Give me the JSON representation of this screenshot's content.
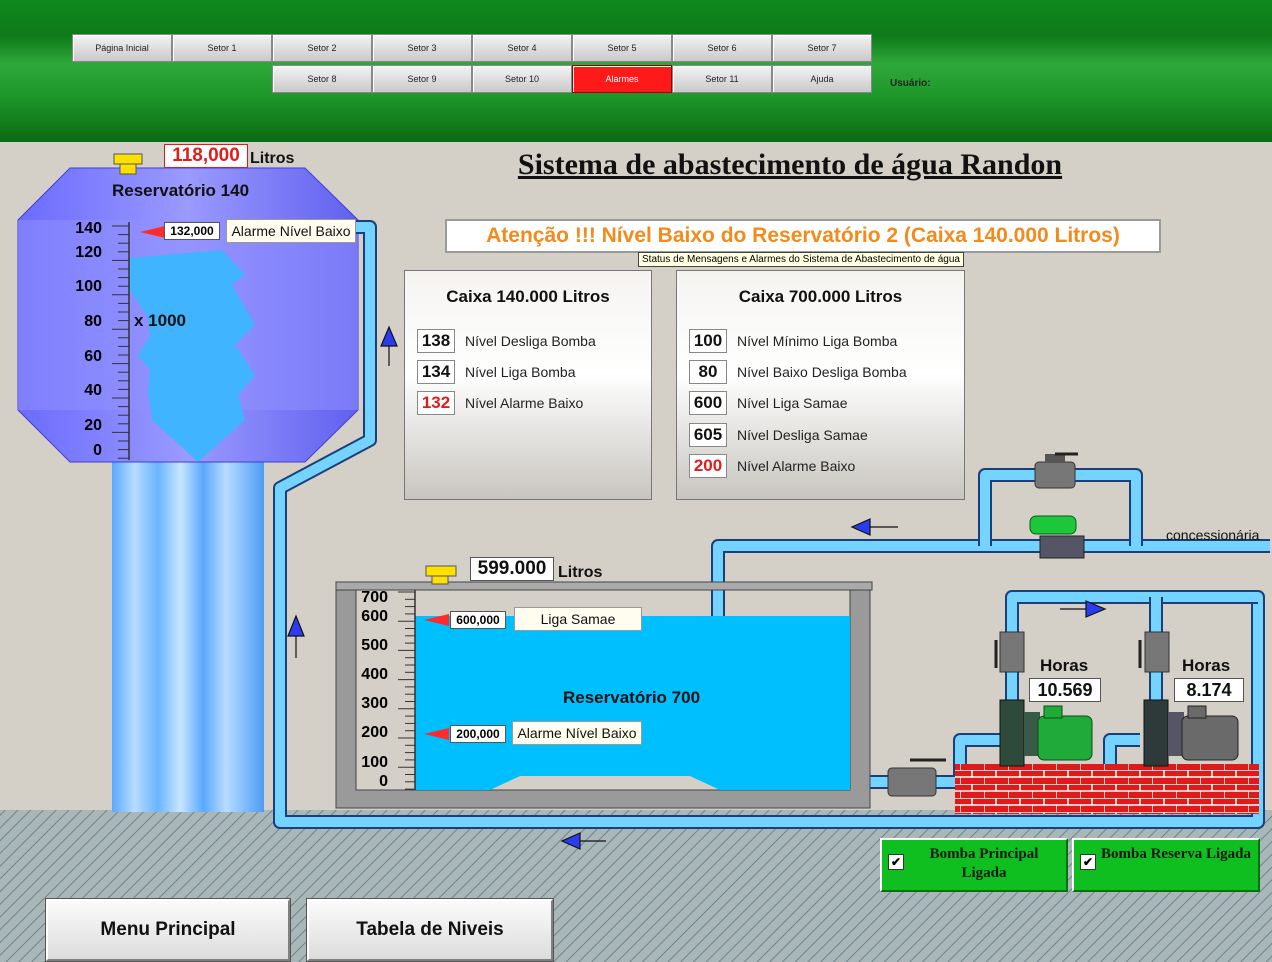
{
  "nav": {
    "row1": [
      "Página Inicial",
      "Setor 1",
      "Setor 2",
      "Setor 3",
      "Setor 4",
      "Setor 5",
      "Setor 6",
      "Setor 7"
    ],
    "row2": [
      "Setor 8",
      "Setor 9",
      "Setor 10",
      "Alarmes",
      "Setor 11",
      "Ajuda"
    ],
    "usuario_label": "Usuário:"
  },
  "colors": {
    "alarm_button": "#ff1a1a",
    "water": "#00bfff",
    "header_green": "#0e7a18",
    "alert_text": "#f28a1c"
  },
  "title": "Sistema de abastecimento de água Randon",
  "alert": {
    "message": "Atenção !!! Nível Baixo do Reservatório 2 (Caixa 140.000 Litros)",
    "tooltip": "Status de Mensagens e Alarmes do Sistema de Abastecimento de água"
  },
  "reservoir140": {
    "volume": "118,000",
    "volume_unit": "Litros",
    "name": "Reservatório 140",
    "scale_unit": "x 1000",
    "ticks": [
      "140",
      "120",
      "100",
      "80",
      "60",
      "40",
      "20",
      "0"
    ],
    "alarm_value": "132,000",
    "alarm_label": "Alarme Nível Baixo"
  },
  "panel140": {
    "title": "Caixa 140.000 Litros",
    "rows": [
      {
        "value": "138",
        "label": "Nível Desliga Bomba",
        "alarm": false
      },
      {
        "value": "134",
        "label": "Nível Liga Bomba",
        "alarm": false
      },
      {
        "value": "132",
        "label": "Nível Alarme Baixo",
        "alarm": true
      }
    ]
  },
  "panel700": {
    "title": "Caixa 700.000 Litros",
    "rows": [
      {
        "value": "100",
        "label": "Nível Mínimo Liga Bomba",
        "alarm": false
      },
      {
        "value": "80",
        "label": "Nível Baixo Desliga Bomba",
        "alarm": false
      },
      {
        "value": "600",
        "label": "Nível Liga Samae",
        "alarm": false
      },
      {
        "value": "605",
        "label": "Nível Desliga Samae",
        "alarm": false
      },
      {
        "value": "200",
        "label": "Nível Alarme Baixo",
        "alarm": true
      }
    ]
  },
  "reservoir700": {
    "volume": "599.000",
    "volume_unit": "Litros",
    "name": "Reservatório 700",
    "ticks": [
      "700",
      "600",
      "500",
      "400",
      "300",
      "200",
      "100",
      "0"
    ],
    "liga_value": "600,000",
    "liga_label": "Liga Samae",
    "alarm_value": "200,000",
    "alarm_label": "Alarme Nível Baixo"
  },
  "concessionaria_label": "concessionária",
  "pump1": {
    "hours_label": "Horas",
    "hours": "10.569",
    "status": "Bomba Principal Ligada",
    "checked": "✔"
  },
  "pump2": {
    "hours_label": "Horas",
    "hours": "8.174",
    "status": "Bomba Reserva Ligada",
    "checked": "✔"
  },
  "buttons": {
    "menu": "Menu Principal",
    "tabela": "Tabela de Niveis"
  }
}
